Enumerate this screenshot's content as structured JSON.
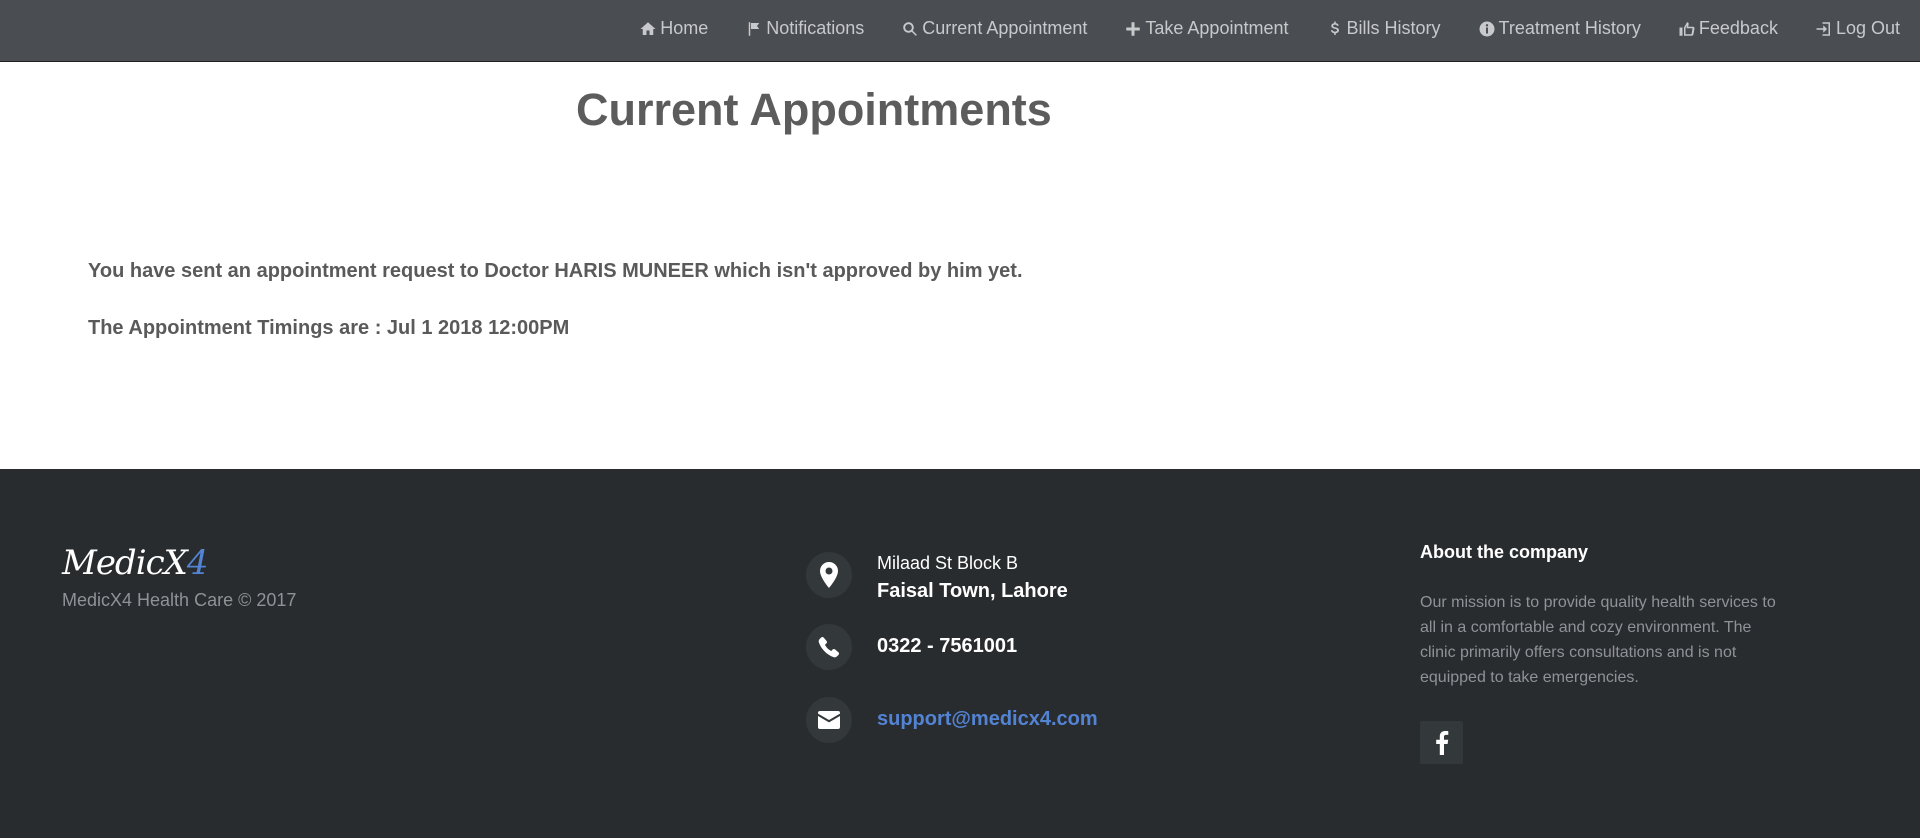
{
  "nav": {
    "items": [
      {
        "label": "Home",
        "icon": "home-icon"
      },
      {
        "label": "Notifications",
        "icon": "flag-icon"
      },
      {
        "label": "Current Appointment",
        "icon": "search-icon"
      },
      {
        "label": "Take Appointment",
        "icon": "plus-icon"
      },
      {
        "label": "Bills History",
        "icon": "dollar-icon"
      },
      {
        "label": "Treatment History",
        "icon": "info-icon"
      },
      {
        "label": "Feedback",
        "icon": "thumbs-up-icon"
      },
      {
        "label": "Log Out",
        "icon": "log-out-icon"
      }
    ]
  },
  "main": {
    "title": "Current Appointments",
    "message": "You have sent an appointment request to Doctor HARIS MUNEER which isn't approved by him yet.",
    "timing": "The Appointment Timings are : Jul 1 2018 12:00PM"
  },
  "footer": {
    "logo_main": "MedicX",
    "logo_accent": "4",
    "copyright": "MedicX4 Health Care © 2017",
    "address_line1": "Milaad St Block B",
    "address_line2": "Faisal Town, Lahore",
    "phone": "0322 - 7561001",
    "email": "support@medicx4.com",
    "about_title": "About the company",
    "about_text": "Our mission is to provide quality health services to all in a comfortable and cozy environment. The clinic primarily offers consultations and is not equipped to take emergencies."
  },
  "colors": {
    "nav_bg": "#4a4d51",
    "footer_bg": "#292c2f",
    "accent": "#5383d3"
  }
}
